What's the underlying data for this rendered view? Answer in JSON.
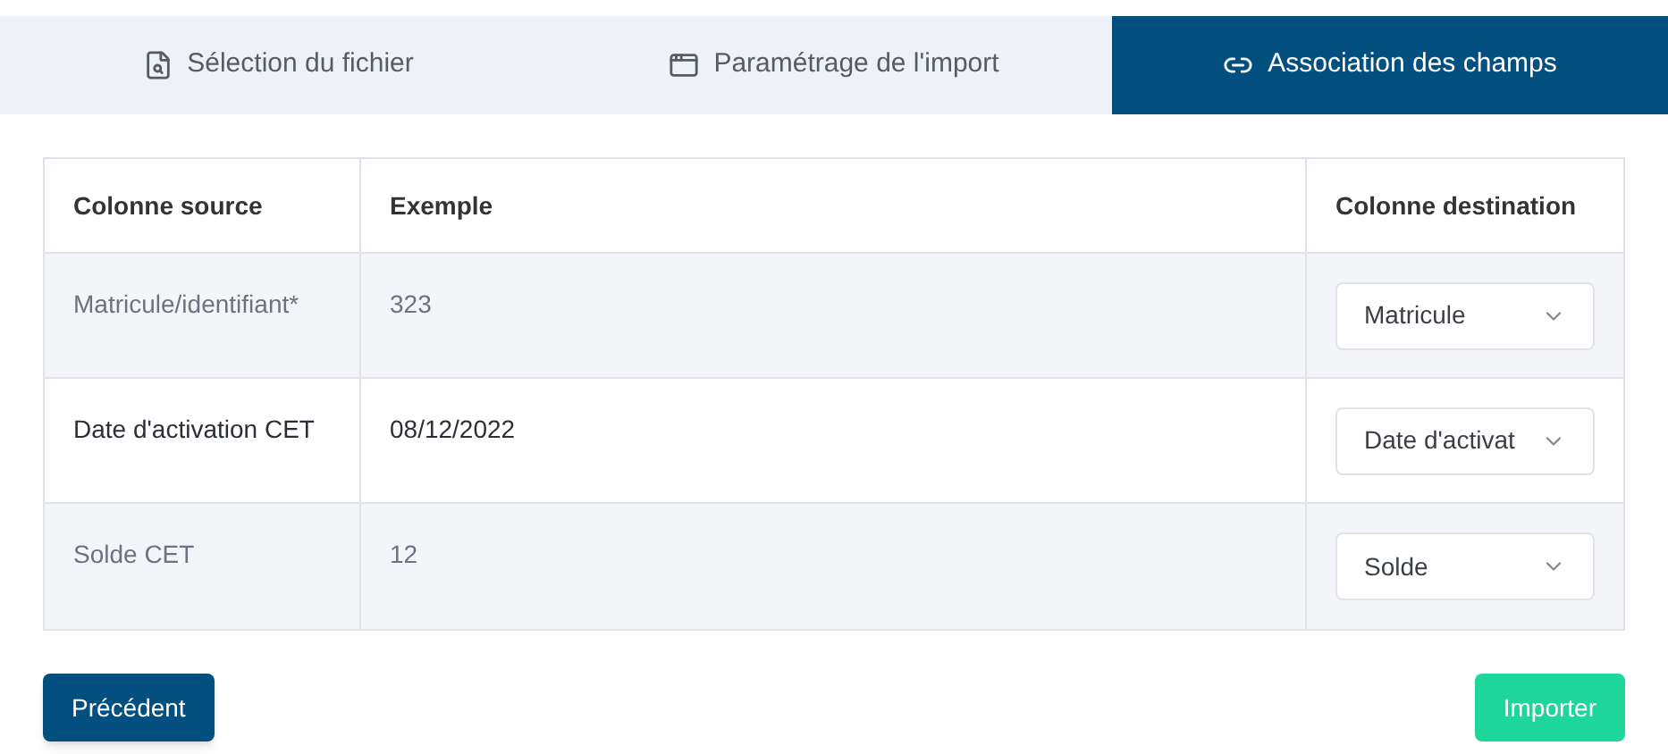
{
  "tabs": [
    {
      "label": "Sélection du fichier",
      "selected": false
    },
    {
      "label": "Paramétrage de l'import",
      "selected": false
    },
    {
      "label": "Association des champs",
      "selected": true
    }
  ],
  "table": {
    "columns": [
      "Colonne source",
      "Exemple",
      "Colonne destination"
    ],
    "rows": [
      {
        "source": "Matricule/identifiant*",
        "example": "323",
        "destination": "Matricule"
      },
      {
        "source": "Date d'activation CET",
        "example": "08/12/2022",
        "destination": "Date d'activat"
      },
      {
        "source": "Solde CET",
        "example": "12",
        "destination": "Solde"
      }
    ]
  },
  "buttons": {
    "previous": "Précédent",
    "import": "Importer"
  }
}
